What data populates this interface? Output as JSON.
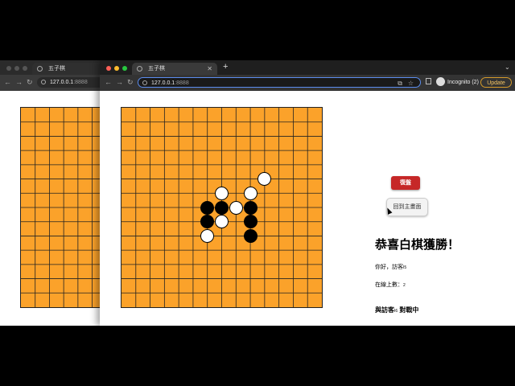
{
  "back_window": {
    "tab_title": "五子棋",
    "url_host": "127.0.0.1",
    "url_port": ":8888"
  },
  "front_window": {
    "tab_title": "五子棋",
    "url_host": "127.0.0.1",
    "url_port": ":8888",
    "incognito_label": "Incognito (2)",
    "update_label": "Update"
  },
  "board": {
    "size": 14,
    "color": "#fba22a",
    "stones": [
      {
        "color": "white",
        "col": 10,
        "row": 5
      },
      {
        "color": "white",
        "col": 7,
        "row": 6
      },
      {
        "color": "white",
        "col": 9,
        "row": 6
      },
      {
        "color": "black",
        "col": 6,
        "row": 7
      },
      {
        "color": "black",
        "col": 7,
        "row": 7
      },
      {
        "color": "white",
        "col": 8,
        "row": 7
      },
      {
        "color": "black",
        "col": 9,
        "row": 7
      },
      {
        "color": "black",
        "col": 6,
        "row": 8
      },
      {
        "color": "white",
        "col": 7,
        "row": 8
      },
      {
        "color": "black",
        "col": 9,
        "row": 8
      },
      {
        "color": "white",
        "col": 6,
        "row": 9
      },
      {
        "color": "black",
        "col": 9,
        "row": 9
      }
    ]
  },
  "panel": {
    "undo_label": "復盤",
    "home_label": "回到主畫面",
    "win_message": "恭喜白棋獲勝！",
    "greeting_prefix": "你好，訪客",
    "greeting_id": "I5",
    "online_prefix": "在線上數：",
    "online_count": "2",
    "vs_prefix": "與訪客",
    "vs_id": "I6",
    "vs_suffix": " 對戰中"
  }
}
